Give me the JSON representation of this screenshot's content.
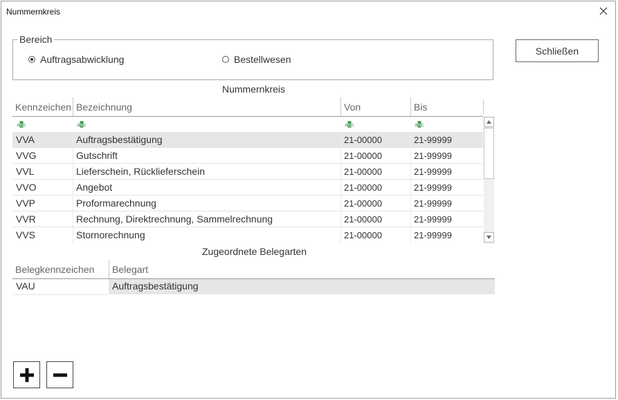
{
  "window": {
    "title": "Nummernkreis"
  },
  "bereich": {
    "legend": "Bereich",
    "options": [
      {
        "label": "Auftragsabwicklung",
        "checked": true
      },
      {
        "label": "Bestellwesen",
        "checked": false
      }
    ]
  },
  "buttons": {
    "close": "Schließen"
  },
  "nummernkreis": {
    "title": "Nummernkreis",
    "columns": [
      "Kennzeichen",
      "Bezeichnung",
      "Von",
      "Bis"
    ],
    "filter_icon": "abc-filter-icon",
    "rows": [
      {
        "kennzeichen": "VVA",
        "bezeichnung": "Auftragsbestätigung",
        "von": "21-00000",
        "bis": "21-99999",
        "selected": true
      },
      {
        "kennzeichen": "VVG",
        "bezeichnung": "Gutschrift",
        "von": "21-00000",
        "bis": "21-99999"
      },
      {
        "kennzeichen": "VVL",
        "bezeichnung": "Lieferschein, Rücklieferschein",
        "von": "21-00000",
        "bis": "21-99999"
      },
      {
        "kennzeichen": "VVO",
        "bezeichnung": "Angebot",
        "von": "21-00000",
        "bis": "21-99999"
      },
      {
        "kennzeichen": "VVP",
        "bezeichnung": "Proformarechnung",
        "von": "21-00000",
        "bis": "21-99999"
      },
      {
        "kennzeichen": "VVR",
        "bezeichnung": "Rechnung, Direktrechnung, Sammelrechnung",
        "von": "21-00000",
        "bis": "21-99999"
      },
      {
        "kennzeichen": "VVS",
        "bezeichnung": "Stornorechnung",
        "von": "21-00000",
        "bis": "21-99999"
      }
    ]
  },
  "belegarten": {
    "title": "Zugeordnete Belegarten",
    "columns": [
      "Belegkennzeichen",
      "Belegart"
    ],
    "rows": [
      {
        "belegkennzeichen": "VAU",
        "belegart": "Auftragsbestätigung"
      }
    ]
  },
  "toolbar": {
    "add_icon": "plus-icon",
    "remove_icon": "minus-icon"
  },
  "colors": {
    "selected_row": "#e6e6e6",
    "abc_icon_green": "#2e8b3a"
  }
}
